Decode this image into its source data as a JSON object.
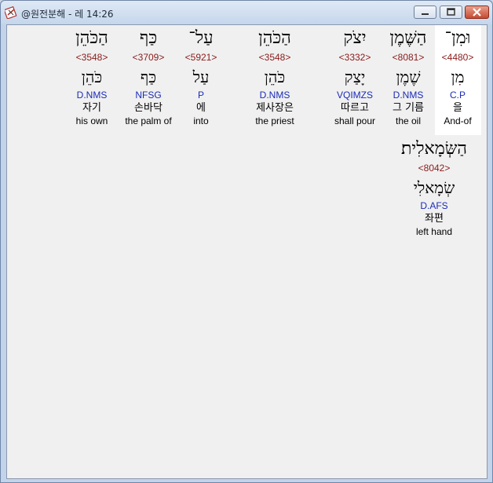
{
  "window": {
    "title": "@원전분해 - 레 14:26"
  },
  "row1": [
    {
      "surface": "וּמִן־",
      "strong": "<4480>",
      "lemma": "מִן",
      "parse": "C.P",
      "korean": "을",
      "english": "And-of"
    },
    {
      "surface": "הַשֶּׁמֶן",
      "strong": "<8081>",
      "lemma": "שֶׁמֶן",
      "parse": "D.NMS",
      "korean": "그 기름",
      "english": "the oil"
    },
    {
      "surface": "יִצֹק",
      "strong": "<3332>",
      "lemma": "יָצַק",
      "parse": "VQIMZS",
      "korean": "따르고",
      "english": "shall pour"
    },
    {
      "surface": "הַכֹּהֵן",
      "strong": "<3548>",
      "lemma": "כֹּהֵן",
      "parse": "D.NMS",
      "korean": "제사장은",
      "english": "the priest"
    },
    {
      "surface": "עַל־",
      "strong": "<5921>",
      "lemma": "עַל",
      "parse": "P",
      "korean": "에",
      "english": "into"
    },
    {
      "surface": "כַּף",
      "strong": "<3709>",
      "lemma": "כַּף",
      "parse": "NFSG",
      "korean": "손바닥",
      "english": "the palm of"
    },
    {
      "surface": "הַכֹּהֵן",
      "strong": "<3548>",
      "lemma": "כֹּהֵן",
      "parse": "D.NMS",
      "korean": "자기",
      "english": "his own"
    }
  ],
  "row2": [
    {
      "surface": "הַשְּׂמָאלִית׃",
      "strong": "<8042>",
      "lemma": "שְׂמָאלִי",
      "parse": "D.AFS",
      "korean": "좌편",
      "english": "left hand"
    }
  ]
}
